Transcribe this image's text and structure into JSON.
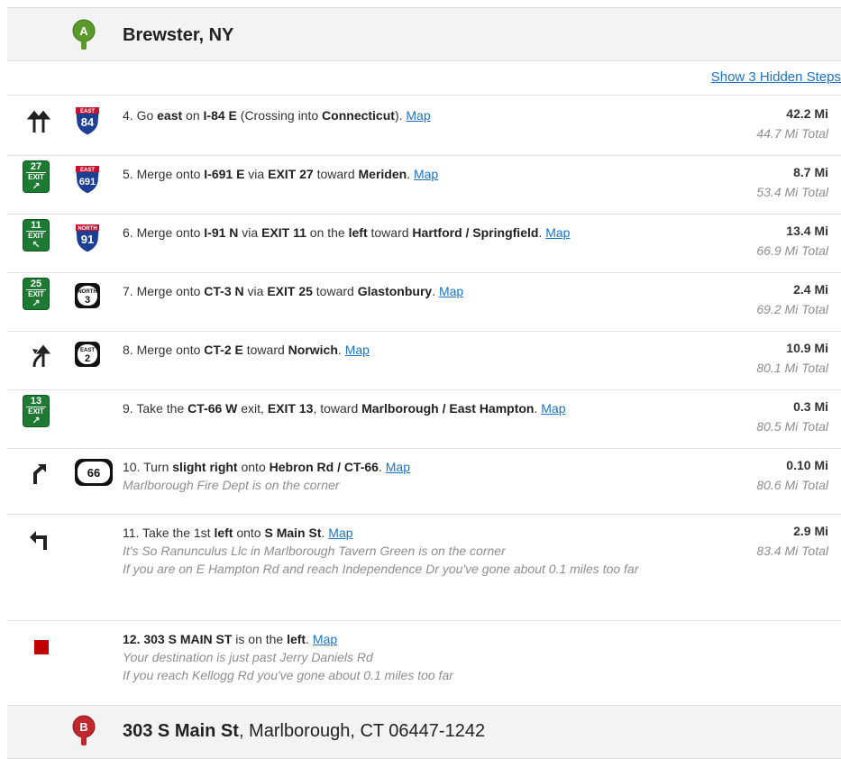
{
  "start": {
    "marker": "A",
    "title": "Brewster, NY"
  },
  "hidden_steps_link": "Show 3 Hidden Steps",
  "steps": [
    {
      "segments": [
        [
          "t",
          "4. Go "
        ],
        [
          "b",
          "east"
        ],
        [
          "t",
          " on "
        ],
        [
          "b",
          "I-84 E"
        ],
        [
          "t",
          " (Crossing into "
        ],
        [
          "b",
          "Connecticut"
        ],
        [
          "t",
          "). "
        ]
      ],
      "map": "Map",
      "notes": [],
      "dist": "42.2 Mi",
      "total": "44.7 Mi Total",
      "sign": "straight-icon",
      "shield": {
        "type": "interstate",
        "dir": "EAST",
        "num": "84"
      }
    },
    {
      "segments": [
        [
          "t",
          "5. Merge onto "
        ],
        [
          "b",
          "I-691 E"
        ],
        [
          "t",
          " via "
        ],
        [
          "b",
          "EXIT 27"
        ],
        [
          "t",
          " toward "
        ],
        [
          "b",
          "Meriden"
        ],
        [
          "t",
          ". "
        ]
      ],
      "map": "Map",
      "notes": [],
      "dist": "8.7 Mi",
      "total": "53.4 Mi Total",
      "exit": {
        "num": "27",
        "word": "EXIT",
        "arrow": "↗"
      },
      "shield": {
        "type": "interstate",
        "dir": "EAST",
        "num": "691"
      }
    },
    {
      "segments": [
        [
          "t",
          "6. Merge onto "
        ],
        [
          "b",
          "I-91 N"
        ],
        [
          "t",
          " via "
        ],
        [
          "b",
          "EXIT 11"
        ],
        [
          "t",
          " on the "
        ],
        [
          "b",
          "left"
        ],
        [
          "t",
          " toward "
        ],
        [
          "b",
          "Hartford / Springfield"
        ],
        [
          "t",
          ". "
        ]
      ],
      "map": "Map",
      "notes": [],
      "dist": "13.4 Mi",
      "total": "66.9 Mi Total",
      "exit": {
        "num": "11",
        "word": "EXIT",
        "arrow": "↖"
      },
      "shield": {
        "type": "interstate",
        "dir": "NORTH",
        "num": "91"
      }
    },
    {
      "segments": [
        [
          "t",
          "7. Merge onto "
        ],
        [
          "b",
          "CT-3 N"
        ],
        [
          "t",
          " via "
        ],
        [
          "b",
          "EXIT 25"
        ],
        [
          "t",
          " toward "
        ],
        [
          "b",
          "Glastonbury"
        ],
        [
          "t",
          ". "
        ]
      ],
      "map": "Map",
      "notes": [],
      "dist": "2.4 Mi",
      "total": "69.2 Mi Total",
      "exit": {
        "num": "25",
        "word": "EXIT",
        "arrow": "↗"
      },
      "shield": {
        "type": "state",
        "dir": "NORTH",
        "num": "3"
      }
    },
    {
      "segments": [
        [
          "t",
          "8. Merge onto "
        ],
        [
          "b",
          "CT-2 E"
        ],
        [
          "t",
          " toward "
        ],
        [
          "b",
          "Norwich"
        ],
        [
          "t",
          ". "
        ]
      ],
      "map": "Map",
      "notes": [],
      "dist": "10.9 Mi",
      "total": "80.1 Mi Total",
      "sign": "merge-icon",
      "shield": {
        "type": "state",
        "dir": "EAST",
        "num": "2"
      }
    },
    {
      "segments": [
        [
          "t",
          "9. Take the "
        ],
        [
          "b",
          "CT-66 W"
        ],
        [
          "t",
          " exit, "
        ],
        [
          "b",
          "EXIT 13"
        ],
        [
          "t",
          ", toward "
        ],
        [
          "b",
          "Marlborough / East Hampton"
        ],
        [
          "t",
          ". "
        ]
      ],
      "map": "Map",
      "notes": [],
      "dist": "0.3 Mi",
      "total": "80.5 Mi Total",
      "exit": {
        "num": "13",
        "word": "EXIT",
        "arrow": "↗"
      }
    },
    {
      "segments": [
        [
          "t",
          "10. Turn "
        ],
        [
          "b",
          "slight right"
        ],
        [
          "t",
          " onto "
        ],
        [
          "b",
          "Hebron Rd / CT-66"
        ],
        [
          "t",
          ". "
        ]
      ],
      "map": "Map",
      "notes": [
        "Marlborough Fire Dept is on the corner"
      ],
      "dist": "0.10 Mi",
      "total": "80.6 Mi Total",
      "sign": "slight-right-icon",
      "shield": {
        "type": "oval",
        "num": "66"
      }
    },
    {
      "segments": [
        [
          "t",
          "11. Take the 1st "
        ],
        [
          "b",
          "left"
        ],
        [
          "t",
          " onto "
        ],
        [
          "b",
          "S Main St"
        ],
        [
          "t",
          ". "
        ]
      ],
      "map": "Map",
      "notes": [
        "It's So Ranunculus Llc in Marlborough Tavern Green is on the corner",
        "If you are on E Hampton Rd and reach Independence Dr you've gone about 0.1 miles too far"
      ],
      "dist": "2.9 Mi",
      "total": "83.4 Mi Total",
      "sign": "turn-left-icon"
    },
    {
      "segments": [
        [
          "b",
          "12. 303 S MAIN ST"
        ],
        [
          "t",
          " is on the "
        ],
        [
          "b",
          "left"
        ],
        [
          "t",
          ". "
        ]
      ],
      "map": "Map",
      "notes": [
        "Your destination is just past Jerry Daniels Rd",
        "If you reach Kellogg Rd you've gone about 0.1 miles too far"
      ],
      "dist": "",
      "total": "",
      "sign": "destination-icon"
    }
  ],
  "end": {
    "marker": "B",
    "title_bold": "303 S Main St",
    "title_rest": ", Marlborough, CT 06447-1242"
  },
  "colors": {
    "link": "#1a73c8",
    "exit_green": "#1d7a33",
    "marker_a": "#5a9a2b",
    "marker_b": "#c0282e",
    "dest": "#c00000"
  }
}
